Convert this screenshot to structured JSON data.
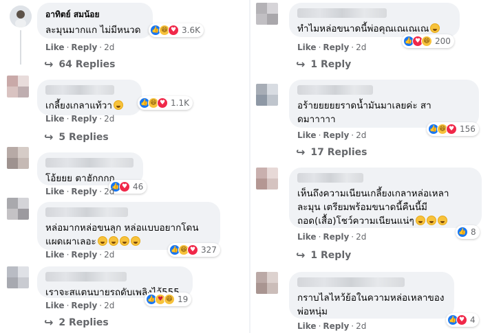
{
  "left": [
    {
      "name": "อาทิตย์ สมน้อย",
      "text": [
        "ละมุนมากแก ไม่มีหนวด"
      ],
      "emoji": 0,
      "reactions": [
        "like",
        "haha",
        "love"
      ],
      "react_count": "3.6K",
      "like": "Like",
      "reply": "Reply",
      "time": "2d",
      "replies": "64 Replies"
    },
    {
      "name": "",
      "text": [
        "เกลี้ยงเกลาแท้วา"
      ],
      "emoji": 1,
      "reactions": [
        "like",
        "haha",
        "love"
      ],
      "react_count": "1.1K",
      "like": "Like",
      "reply": "Reply",
      "time": "2d",
      "replies": "5 Replies"
    },
    {
      "name": "",
      "text": [
        "โอ้ยยย ตาฮักกกก"
      ],
      "emoji": 0,
      "reactions": [
        "like",
        "love"
      ],
      "react_count": "46",
      "like": "Like",
      "reply": "Reply",
      "time": "2d",
      "replies": ""
    },
    {
      "name": "",
      "text": [
        "หล่อมากหล่อขนลุก หล่อแบบอยากโดน",
        "แผดเผาเลอะ"
      ],
      "emoji": 4,
      "reactions": [
        "like",
        "haha",
        "love"
      ],
      "react_count": "327",
      "like": "Like",
      "reply": "Reply",
      "time": "2d",
      "replies": ""
    },
    {
      "name": "",
      "text": [
        "เราจะสแตนบายรถดับเพลิงไว้555"
      ],
      "emoji": 0,
      "reactions": [
        "like",
        "care",
        "haha"
      ],
      "react_count": "19",
      "like": "Like",
      "reply": "Reply",
      "time": "2d",
      "replies": "2 Replies"
    }
  ],
  "right": [
    {
      "name": "",
      "text": [
        "ทำไมหล่อขนาดนี้พ่อคุณเณเณเณ"
      ],
      "emoji": 1,
      "reactions": [
        "like",
        "love",
        "haha"
      ],
      "react_count": "200",
      "like": "Like",
      "reply": "Reply",
      "time": "2d",
      "replies": "1 Reply"
    },
    {
      "name": "",
      "text": [
        "อร้ายยยยยราดน้ำมันมาเลยค่ะ สา",
        "ดมาาาาา"
      ],
      "emoji": 0,
      "reactions": [
        "like",
        "haha",
        "love"
      ],
      "react_count": "156",
      "like": "Like",
      "reply": "Reply",
      "time": "2d",
      "replies": "17 Replies"
    },
    {
      "name": "",
      "text": [
        "เห็นถึงความเนียนเกลี้ยงเกลาหล่อเหลา",
        "ละมุน เตรียมพร้อมขนาดนี้คืนนี้มี",
        "ถอด(เสื้อ)โชว์ความเนียนแน่ๆ"
      ],
      "emoji": 3,
      "reactions": [
        "like"
      ],
      "react_count": "8",
      "like": "Like",
      "reply": "Reply",
      "time": "2d",
      "replies": "1 Reply"
    },
    {
      "name": "",
      "text": [
        "กราบไลไหว้ย้อในความหล่อเหลาของ",
        "พ่อหนุ่ม"
      ],
      "emoji": 0,
      "reactions": [
        "like",
        "love"
      ],
      "react_count": "4",
      "like": "Like",
      "reply": "Reply",
      "time": "2d",
      "replies": ""
    }
  ],
  "colors": {
    "bubble": "#f0f2f5",
    "meta": "#65676b",
    "like": "#1877f2",
    "love": "#f02849",
    "haha": "#f7c23b"
  }
}
